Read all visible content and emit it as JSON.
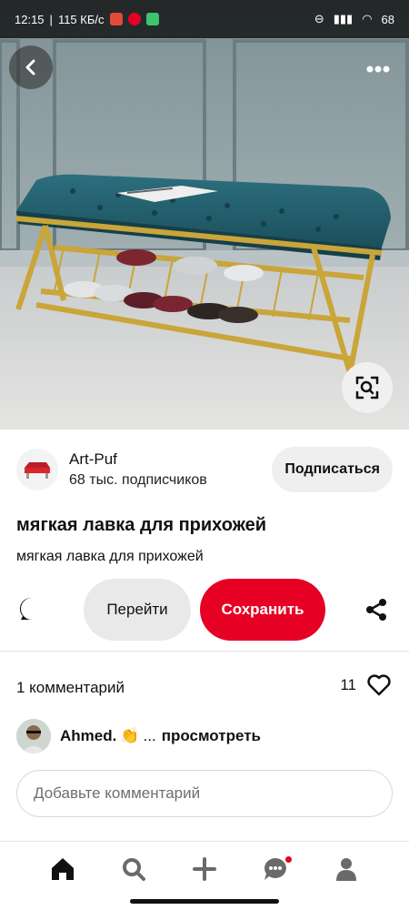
{
  "status_bar": {
    "time": "12:15",
    "network_speed": "115 КБ/с",
    "battery": "68"
  },
  "hero": {
    "back_icon": "chevron-left-icon",
    "more_icon": "more-horizontal-icon",
    "lens_icon": "visual-search-icon"
  },
  "creator": {
    "name": "Art-Puf",
    "followers": "68 тыс. подписчиков",
    "follow_label": "Подписаться"
  },
  "pin": {
    "title": "мягкая лавка для прихожей",
    "description": "мягкая лавка для прихожей"
  },
  "actions": {
    "visit_label": "Перейти",
    "save_label": "Сохранить",
    "react_icon": "heart-bubble-icon",
    "share_icon": "share-icon"
  },
  "comments": {
    "count_label": "1 комментарий",
    "likes_count": "11",
    "first": {
      "author": "Ahmed.",
      "emoji": "👏",
      "ellipsis": "...",
      "view_label": "просмотреть"
    },
    "input_placeholder": "Добавьте комментарий"
  },
  "bottom_nav": {
    "items": [
      "home-icon",
      "search-icon",
      "create-icon",
      "messages-icon",
      "profile-icon"
    ]
  },
  "colors": {
    "accent": "#e60023",
    "button_gray": "#e9e9e9"
  }
}
